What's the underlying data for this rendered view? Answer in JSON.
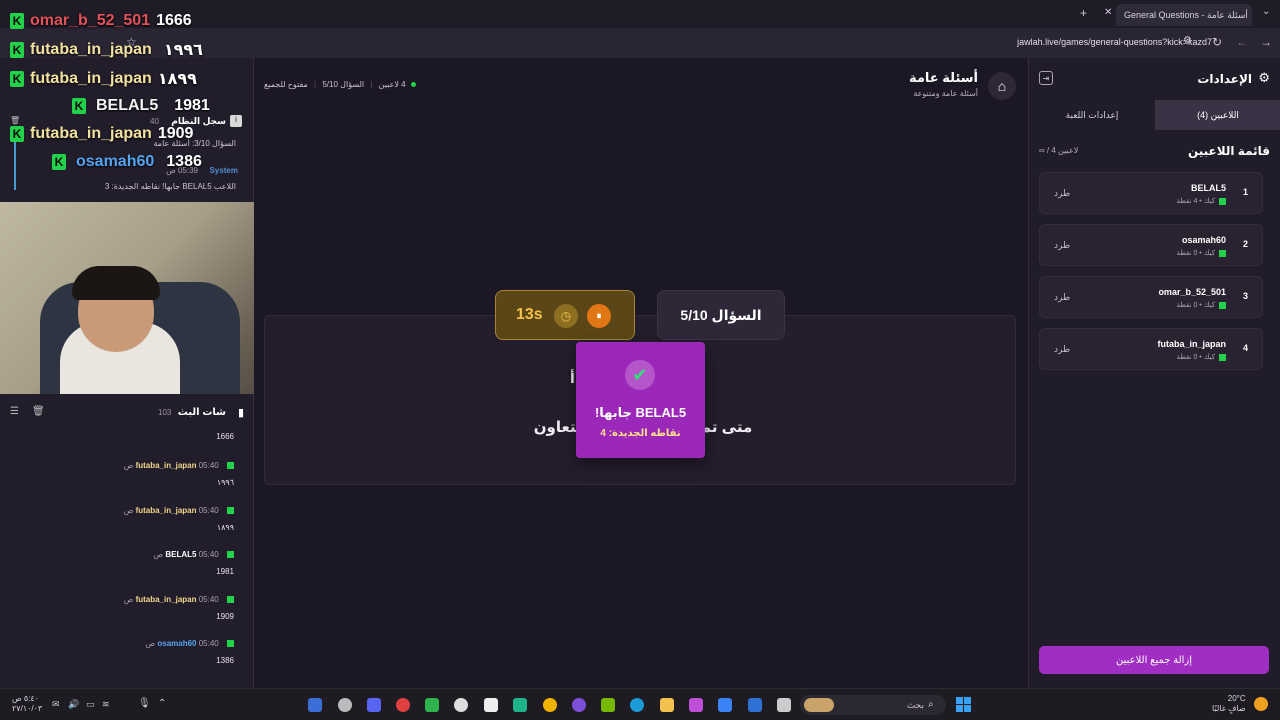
{
  "browser": {
    "tab_title": "General Questions - أسئلة عامة",
    "url": "jawlah.live/games/general-questions?kick=kazd7"
  },
  "overlay": {
    "rows": [
      {
        "name": "omar_b_52_501",
        "score": "1666",
        "style": "red"
      },
      {
        "name": "futaba_in_japan",
        "score": "١٩٩٦",
        "style": "yellow"
      },
      {
        "name": "futaba_in_japan",
        "score": "١٨٩٩",
        "style": "yellow"
      },
      {
        "name": "BELAL5",
        "score": "1981",
        "style": "white"
      },
      {
        "name": "futaba_in_japan",
        "score": "1909",
        "style": "yellow"
      },
      {
        "name": "osamah60",
        "score": "1386",
        "style": "blue"
      }
    ]
  },
  "system_log": {
    "title": "سجل النظام",
    "count": "40",
    "q_line": "السؤال 3/10: أسئلة عامة",
    "sender": "System",
    "time": "05:39 ص",
    "message": "اللاعب BELAL5 جابها! نقاطه الجديدة: 3"
  },
  "chat": {
    "title": "شات البث",
    "count": "103",
    "first_body": "1666",
    "messages": [
      {
        "user": "futaba_in_japan",
        "time": "05:40 ص",
        "body": "١٩٩٦"
      },
      {
        "user": "futaba_in_japan",
        "time": "05:40 ص",
        "body": "١٨٩٩"
      },
      {
        "user": "BELAL5",
        "time": "05:40 ص",
        "body": "1981"
      },
      {
        "user": "futaba_in_japan",
        "time": "05:40 ص",
        "body": "1909"
      },
      {
        "user": "osamah60",
        "time": "05:40 ص",
        "body": "1386"
      }
    ]
  },
  "main": {
    "title": "أسئلة عامة",
    "subtitle": "أسئلة عامة ومتنوعة",
    "players_status": "4 لاعبين",
    "question_status": "السؤال 5/10",
    "open_status": "مفتوح للجميع",
    "question_counter": "السؤال 5/10",
    "timer": "13s",
    "category_partial": "أ",
    "question_text": "متى تم تأسيس مجلس التعاون الخليجي؟",
    "popup_line1": "BELAL5 جابها!",
    "popup_line2": "نقاطه الجديدة: 4"
  },
  "settings": {
    "title": "الإعدادات",
    "tab_players": "اللاعبين (4)",
    "tab_game": "إعدادات اللعبة",
    "players_heading": "قائمة اللاعبين",
    "players_count": "∞ / 4 لاعبين",
    "kick_label": "طرد",
    "remove_all": "إزالة جميع اللاعبين",
    "players": [
      {
        "rank": "1",
        "name": "BELAL5",
        "meta": "كيك • 4 نقطة"
      },
      {
        "rank": "2",
        "name": "osamah60",
        "meta": "كيك • 0 نقطة"
      },
      {
        "rank": "3",
        "name": "omar_b_52_501",
        "meta": "كيك • 0 نقطة"
      },
      {
        "rank": "4",
        "name": "futaba_in_japan",
        "meta": "كيك • 0 نقطة"
      }
    ]
  },
  "taskbar": {
    "search_placeholder": "بحث",
    "clock_time": "٥:٤٠ ص",
    "clock_date": "٢٧/١٠/٠٣",
    "weather_temp": "20°C",
    "weather_desc": "صافٍ غالبًا"
  },
  "colors": {
    "accent": "#9b28b8",
    "kick_green": "#22d34a",
    "timer_gold": "#f4c24a"
  }
}
